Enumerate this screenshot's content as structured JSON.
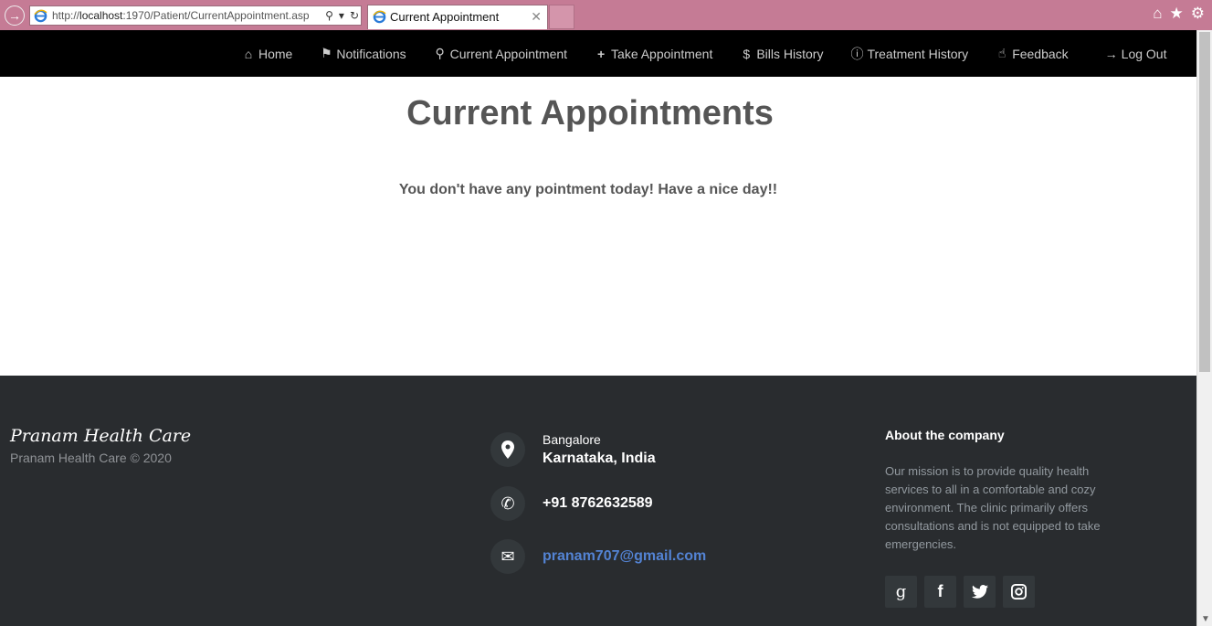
{
  "browser": {
    "address_prefix": "http://",
    "address_host": "localhost",
    "address_rest": ":1970/Patient/CurrentAppointment.asp",
    "tab_title": "Current Appointment"
  },
  "nav": {
    "items": [
      {
        "label": "Home",
        "icon": "home-icon"
      },
      {
        "label": "Notifications",
        "icon": "flag-icon"
      },
      {
        "label": "Current Appointment",
        "icon": "search-icon"
      },
      {
        "label": "Take Appointment",
        "icon": "plus-icon"
      },
      {
        "label": "Bills History",
        "icon": "dollar-icon"
      },
      {
        "label": "Treatment History",
        "icon": "info-icon"
      },
      {
        "label": "Feedback",
        "icon": "thumbs-up-icon"
      }
    ],
    "logout_label": "Log Out"
  },
  "main": {
    "title": "Current Appointments",
    "message": "You don't have any pointment today! Have a nice day!!"
  },
  "footer": {
    "brand": "Pranam Health Care",
    "copyright": "Pranam Health Care © 2020",
    "city": "Bangalore",
    "state": "Karnataka, India",
    "phone": "+91 8762632589",
    "email": "pranam707@gmail.com",
    "about_title": "About the company",
    "about_text": "Our mission is to provide quality health services to all in a comfortable and cozy environment. The clinic primarily offers consultations and is not equipped to take emergencies."
  },
  "colors": {
    "chrome": "#c57b95",
    "navbar": "#000000",
    "footer": "#292c2f",
    "email_link": "#5383d3"
  }
}
